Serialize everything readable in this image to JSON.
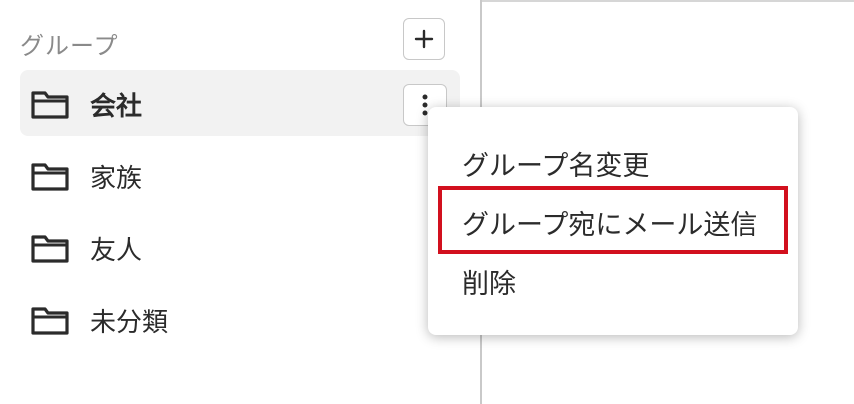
{
  "sidebar": {
    "title": "グループ",
    "add_icon": "plus-icon",
    "groups": [
      {
        "label": "会社",
        "icon": "folder-icon",
        "active": true
      },
      {
        "label": "家族",
        "icon": "folder-icon"
      },
      {
        "label": "友人",
        "icon": "folder-icon"
      },
      {
        "label": "未分類",
        "icon": "folder-icon"
      }
    ],
    "more_icon": "more-vertical-icon"
  },
  "context_menu": {
    "items": [
      {
        "label": "グループ名変更"
      },
      {
        "label": "グループ宛にメール送信",
        "highlighted": true
      },
      {
        "label": "削除"
      }
    ],
    "highlight_color": "#d2101e"
  }
}
